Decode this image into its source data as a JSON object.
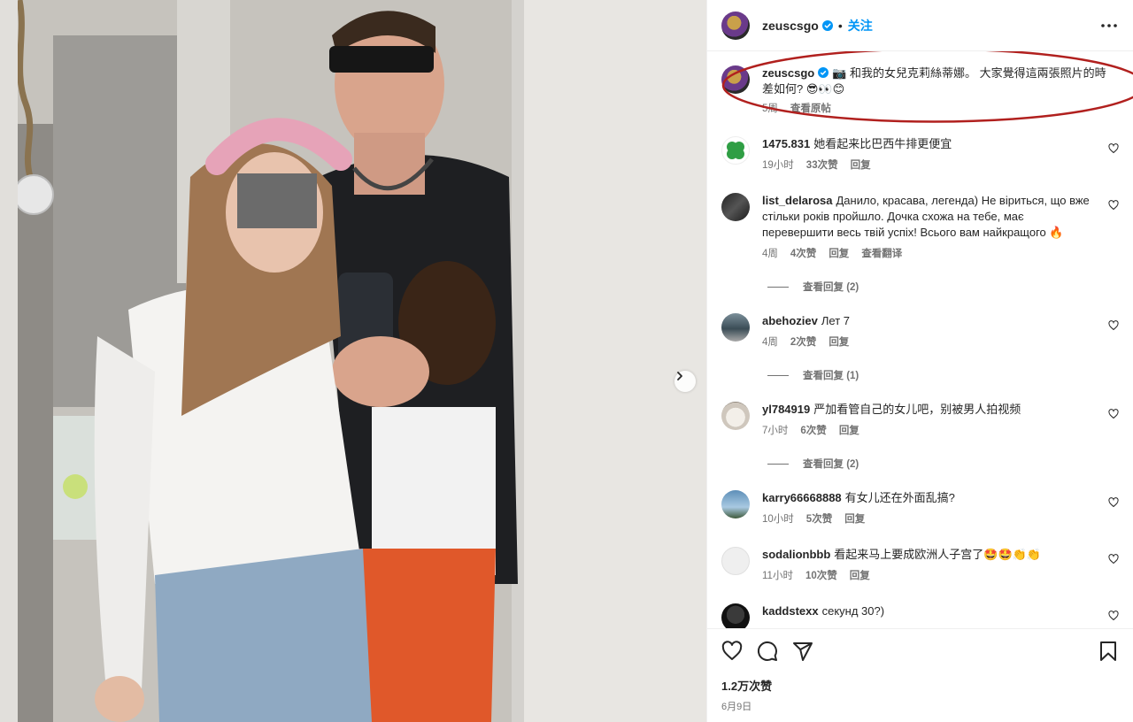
{
  "header": {
    "username": "zeuscsgo",
    "separator": "•",
    "follow_label": "关注"
  },
  "caption": {
    "username": "zeuscsgo",
    "text": "📷 和我的女兒克莉絲蒂娜。 大家覺得這兩張照片的時差如何? 😎👀😊",
    "time": "5周",
    "translate_label": "查看原帖"
  },
  "comments": [
    {
      "username": "1475.831",
      "text": "她看起来比巴西牛排更便宜",
      "time": "19小时",
      "likes": "33次赞",
      "reply_label": "回复"
    },
    {
      "username": "list_delarosa",
      "text": "Данило, красава, легенда) Не віриться, що вже стільки років пройшло. Дочка схожа на тебе, має перевершити весь твій успіх! Всього вам найкращого 🔥",
      "time": "4周",
      "likes": "4次赞",
      "reply_label": "回复",
      "translate_label": "查看翻译",
      "view_replies": "查看回复 (2)"
    },
    {
      "username": "abehoziev",
      "text": "Лет 7",
      "time": "4周",
      "likes": "2次赞",
      "reply_label": "回复",
      "view_replies": "查看回复 (1)"
    },
    {
      "username": "yl784919",
      "text": "严加看管自己的女儿吧，别被男人拍视频",
      "time": "7小时",
      "likes": "6次赞",
      "reply_label": "回复",
      "view_replies": "查看回复 (2)"
    },
    {
      "username": "karry66668888",
      "text": "有女儿还在外面乱搞?",
      "time": "10小时",
      "likes": "5次赞",
      "reply_label": "回复"
    },
    {
      "username": "sodalionbbb",
      "text": "看起来马上要成欧洲人子宫了🤩🤩👏👏",
      "time": "11小时",
      "likes": "10次赞",
      "reply_label": "回复"
    },
    {
      "username": "kaddstexx",
      "text": "секунд 30?)"
    }
  ],
  "footer": {
    "likes": "1.2万次赞",
    "date": "6月9日"
  },
  "icons": {
    "like": "heart-icon",
    "comment": "comment-icon",
    "share": "share-icon",
    "save": "bookmark-icon",
    "more": "more-icon",
    "next": "chevron-right-icon"
  },
  "colors": {
    "accent": "#0095f6",
    "verified": "#0095f6",
    "highlight_ellipse": "#b1201e",
    "secondary_text": "#737373"
  }
}
